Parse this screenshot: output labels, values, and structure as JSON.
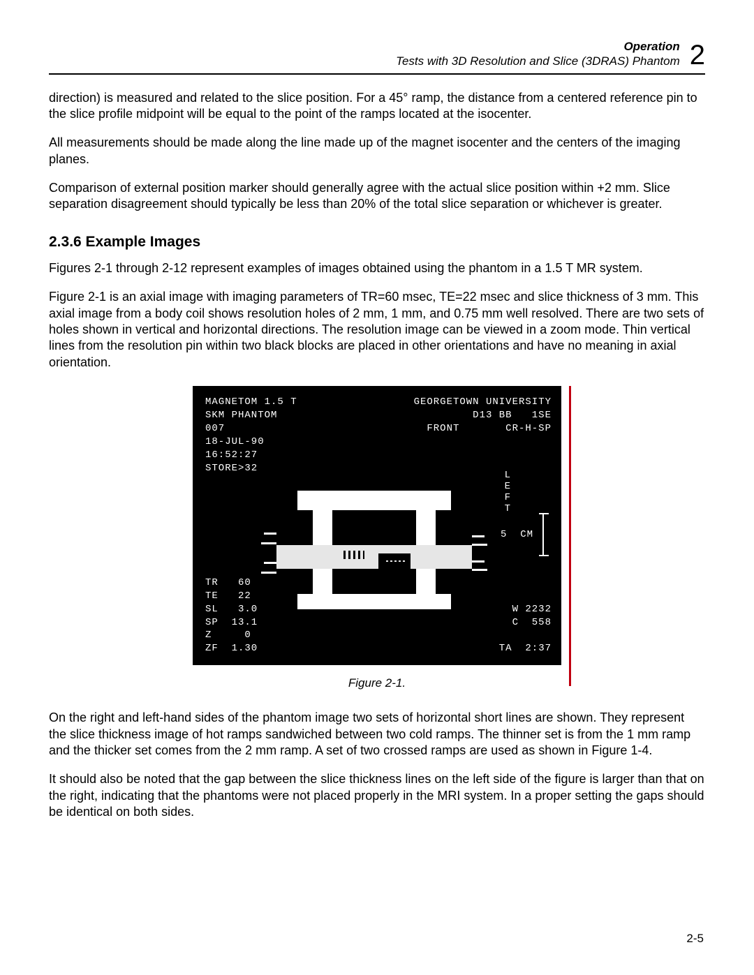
{
  "header": {
    "section": "Operation",
    "subtitle": "Tests with 3D Resolution and Slice (3DRAS) Phantom",
    "chapter": "2"
  },
  "paragraphs": {
    "p1": "direction) is measured and related to the slice position.  For a 45° ramp, the distance from a centered reference pin to the slice profile midpoint will be equal to the point of the ramps located at the isocenter.",
    "p2": "All measurements should be made along the line made up of the magnet isocenter and the centers of the imaging planes.",
    "p3": "Comparison of external position marker should generally agree with the actual slice position within +2 mm. Slice separation disagreement should typically be less than 20% of the total slice separation or whichever is greater.",
    "h3": "2.3.6 Example Images",
    "p4": "Figures 2-1 through 2-12 represent examples of images obtained using the phantom in a 1.5 T MR system.",
    "p5": "Figure 2-1 is an axial image with imaging parameters of TR=60 msec, TE=22 msec and slice thickness of 3 mm. This axial image from a body coil shows resolution holes of 2 mm, 1 mm, and 0.75 mm well resolved. There are two sets of holes shown in vertical and horizontal directions. The resolution image can be viewed in a zoom mode. Thin vertical lines from the resolution pin within two black blocks are placed in other orientations and have no meaning in axial orientation.",
    "p6": "On the right and left-hand sides of the phantom image two sets of horizontal short lines are shown. They represent the slice thickness image of hot ramps sandwiched between two cold ramps. The thinner set is from the 1 mm ramp and the thicker set comes from the 2 mm ramp. A set of two crossed ramps are used as shown in Figure 1-4.",
    "p7": "It should also be noted that the gap between the slice thickness lines on the left side of the figure is larger than that on the right, indicating that the phantoms were not placed properly in the MRI system. In a proper setting the gaps should be identical on both sides."
  },
  "figure": {
    "caption": "Figure 2-1.",
    "overlay": {
      "top_left": "MAGNETOM 1.5 T\nSKM PHANTOM\n007\n18-JUL-90\n16:52:27\nSTORE>32",
      "top_right": "GEORGETOWN UNIVERSITY\nD13 BB   1SE\nFRONT       CR-H-SP",
      "left_vertical": "L\nE\nF\nT",
      "scale": "5  CM",
      "bottom_left": "TR   60\nTE   22\nSL   3.0\nSP  13.1\nZ     0\nZF  1.30",
      "bottom_right": "W 2232\nC  558\n\nTA  2:37"
    }
  },
  "page_number": "2-5"
}
